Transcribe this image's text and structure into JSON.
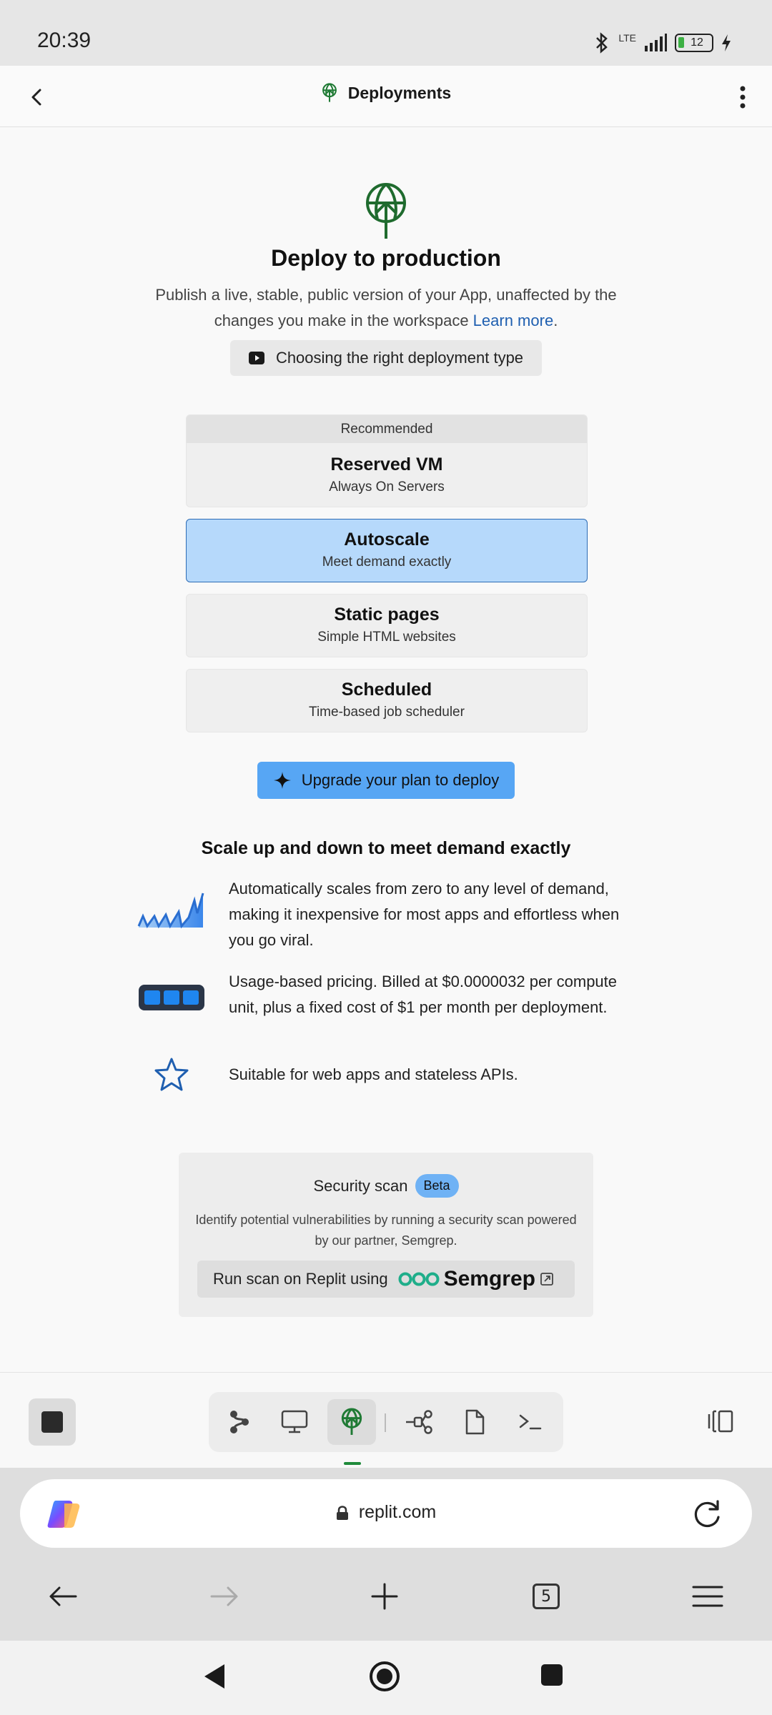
{
  "status_bar": {
    "time": "20:39",
    "network": "LTE",
    "battery": "12"
  },
  "header": {
    "title": "Deployments"
  },
  "hero": {
    "title": "Deploy to production",
    "description": "Publish a live, stable, public version of your App, unaffected by the changes you make in the workspace ",
    "learn_more": "Learn more",
    "period": ".",
    "video_label": "Choosing the right deployment type"
  },
  "deployment_options": [
    {
      "badge": "Recommended",
      "name": "Reserved VM",
      "subtitle": "Always On Servers",
      "selected": false
    },
    {
      "name": "Autoscale",
      "subtitle": "Meet demand exactly",
      "selected": true
    },
    {
      "name": "Static pages",
      "subtitle": "Simple HTML websites",
      "selected": false
    },
    {
      "name": "Scheduled",
      "subtitle": "Time-based job scheduler",
      "selected": false
    }
  ],
  "upgrade_button": "Upgrade your plan to deploy",
  "features": {
    "title": "Scale up and down to meet demand exactly",
    "items": [
      {
        "icon": "scaling-chart-icon",
        "text": "Automatically scales from zero to any level of demand, making it inexpensive for most apps and effortless when you go viral."
      },
      {
        "icon": "battery-usage-icon",
        "text": "Usage-based pricing. Billed at $0.0000032 per compute unit, plus a fixed cost of $1 per month per deployment."
      },
      {
        "icon": "star-icon",
        "text": "Suitable for web apps and stateless APIs."
      }
    ]
  },
  "security_scan": {
    "title": "Security scan",
    "badge": "Beta",
    "description": "Identify potential vulnerabilities by running a security scan powered by our partner, Semgrep.",
    "button_label": "Run scan on Replit using",
    "partner": "Semgrep"
  },
  "browser": {
    "url": "replit.com",
    "tab_count": "5"
  },
  "colors": {
    "accent_green": "#1f7a34",
    "selected_bg": "#b6d9fb",
    "primary_button": "#57a6f4",
    "link": "#1f5fb0"
  }
}
